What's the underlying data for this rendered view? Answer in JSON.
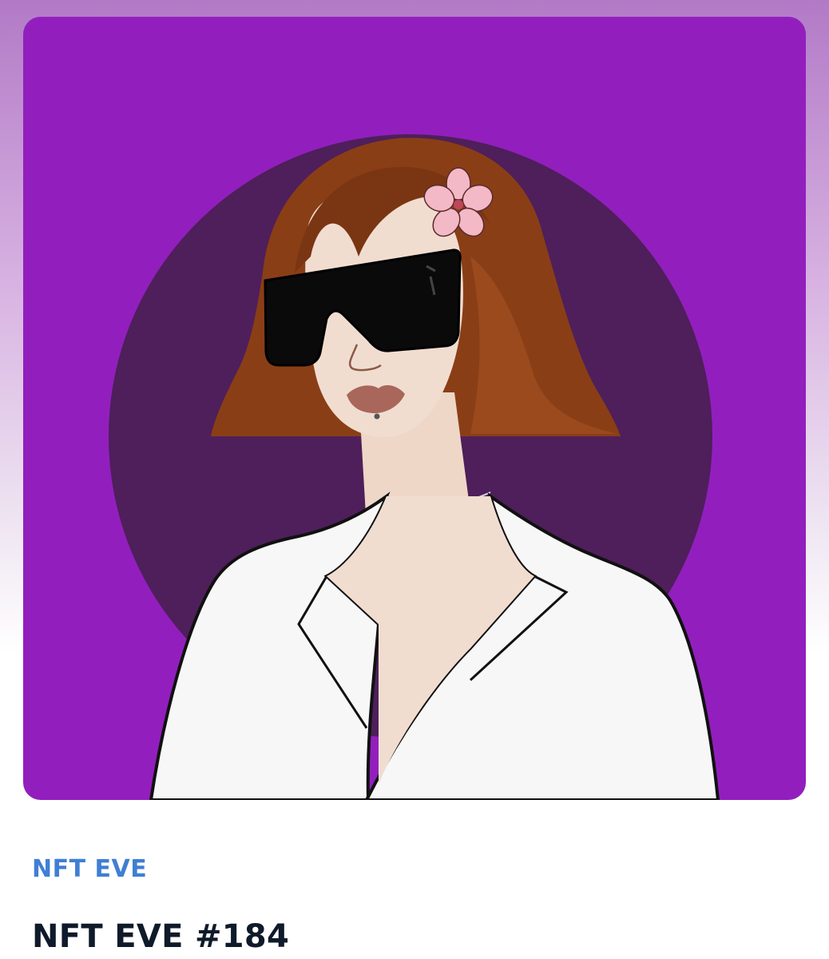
{
  "nft": {
    "collection": "NFT EVE",
    "title": "NFT EVE #184"
  },
  "artwork": {
    "background_color": "#921fbd",
    "circle_color": "#4e1f5a",
    "hair_color": "#8a3e16",
    "jacket_color": "#f7f7f7",
    "lens_color": "#0a0a0a",
    "flower_color": "#f3b9c6",
    "skin_color": "#f1ddd0",
    "lip_color": "#a8675a"
  },
  "colors": {
    "collection_link": "#3f7fd3",
    "title_text": "#0f1a2a"
  }
}
